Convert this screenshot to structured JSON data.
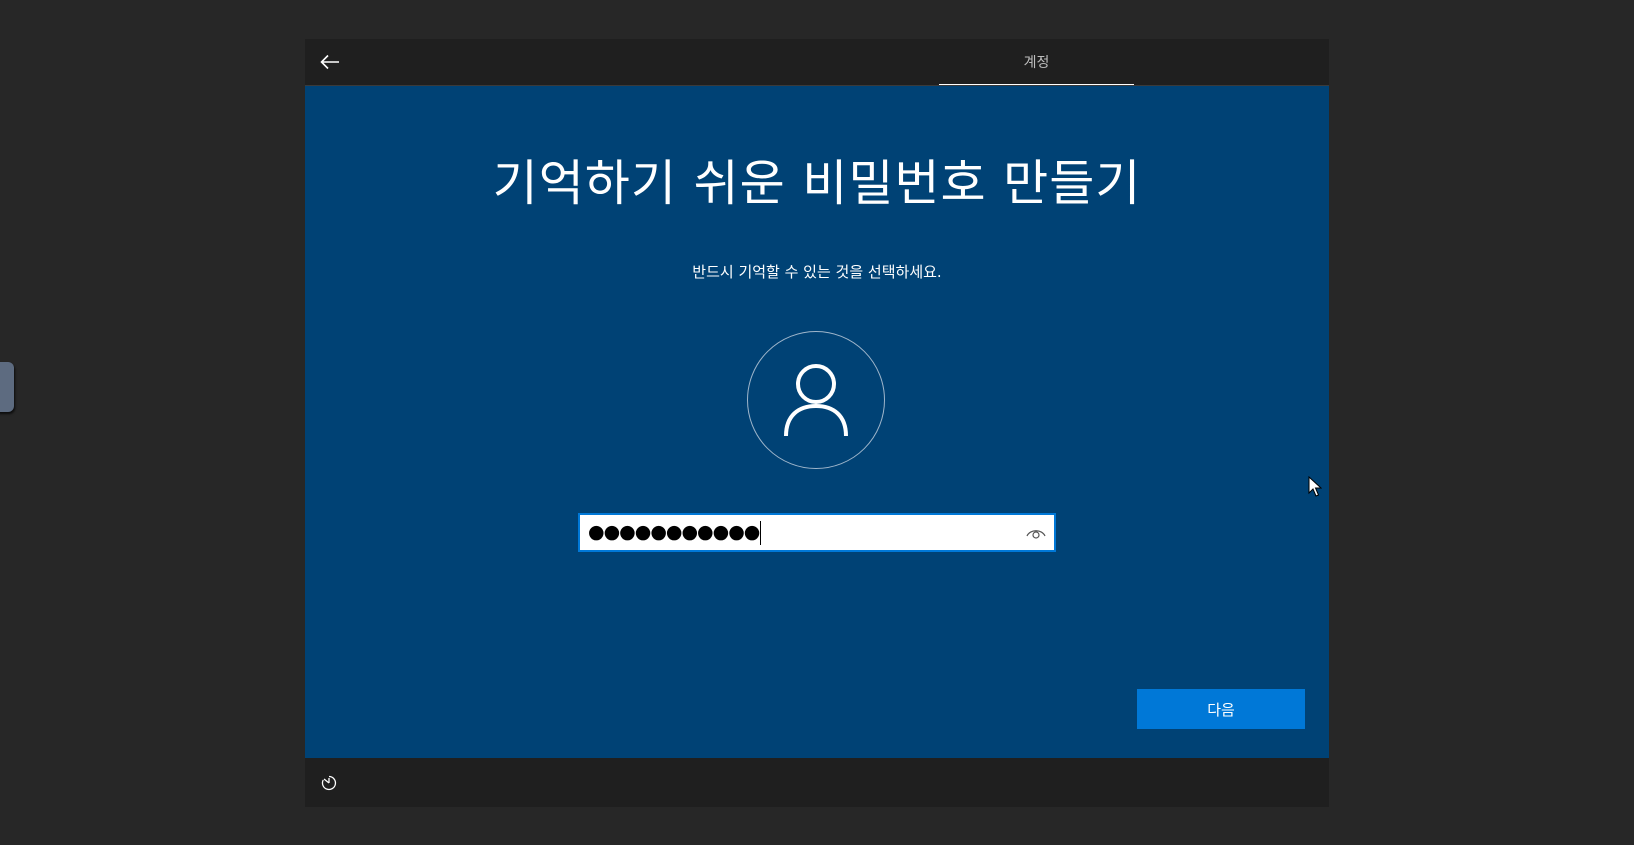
{
  "header": {
    "back_icon": "arrow-left-icon",
    "tab_label": "계정"
  },
  "main": {
    "title": "기억하기 쉬운 비밀번호 만들기",
    "subtitle": "반드시 기억할 수 있는 것을 선택하세요.",
    "avatar_icon": "person-icon",
    "password": {
      "masked_value": "●●●●●●●●●●●",
      "reveal_icon": "eye-icon"
    },
    "next_label": "다음"
  },
  "footer": {
    "ease_of_access_icon": "ease-of-access-icon"
  },
  "colors": {
    "content_bg": "#004275",
    "chrome_bg": "#1f1f1f",
    "accent": "#0078d7",
    "desktop_bg": "#272727"
  }
}
